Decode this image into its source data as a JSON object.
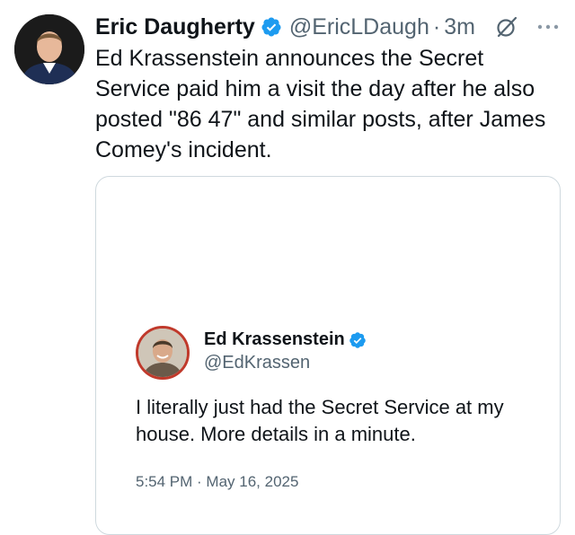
{
  "tweet": {
    "display_name": "Eric Daugherty",
    "handle": "@EricLDaugh",
    "separator": "·",
    "time": "3m",
    "text": "Ed Krassenstein announces the Secret Service paid him a visit the day after he also posted \"86 47\" and similar posts, after James Comey's incident.",
    "colors": {
      "verified": "#1d9bf0",
      "muted": "#536471",
      "text": "#0f1419",
      "border": "#cfd9de"
    },
    "icons": {
      "verified": "verified-badge-icon",
      "grok": "grok-icon",
      "more": "more-options-icon"
    }
  },
  "quoted": {
    "display_name": "Ed Krassenstein",
    "handle": "@EdKrassen",
    "text": "I literally just had the Secret Service at my house. More details in a minute.",
    "timestamp": "5:54 PM · May 16, 2025",
    "avatar_ring_color": "#c0392b"
  }
}
